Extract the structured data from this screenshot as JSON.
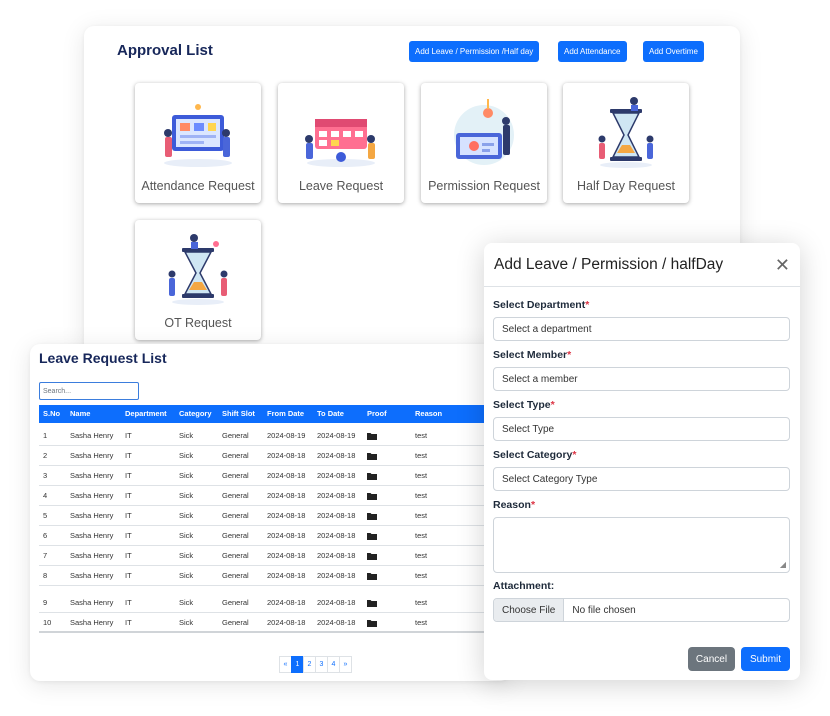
{
  "approval": {
    "title": "Approval List",
    "buttons": [
      "Add Leave / Permission /Half day",
      "Add Attendance",
      "Add Overtime"
    ],
    "tiles": [
      "Attendance Request",
      "Leave Request",
      "Permission Request",
      "Half Day Request",
      "OT Request"
    ]
  },
  "leave_list": {
    "title": "Leave Request List",
    "search_placeholder": "Search...",
    "columns": [
      "S.No",
      "Name",
      "Department",
      "Category",
      "Shift Slot",
      "From Date",
      "To Date",
      "Proof",
      "Reason"
    ],
    "rows": [
      [
        "1",
        "Sasha Henry",
        "IT",
        "Sick",
        "General",
        "2024-08-19",
        "2024-08-19",
        "test"
      ],
      [
        "2",
        "Sasha Henry",
        "IT",
        "Sick",
        "General",
        "2024-08-18",
        "2024-08-18",
        "test"
      ],
      [
        "3",
        "Sasha Henry",
        "IT",
        "Sick",
        "General",
        "2024-08-18",
        "2024-08-18",
        "test"
      ],
      [
        "4",
        "Sasha Henry",
        "IT",
        "Sick",
        "General",
        "2024-08-18",
        "2024-08-18",
        "test"
      ],
      [
        "5",
        "Sasha Henry",
        "IT",
        "Sick",
        "General",
        "2024-08-18",
        "2024-08-18",
        "test"
      ],
      [
        "6",
        "Sasha Henry",
        "IT",
        "Sick",
        "General",
        "2024-08-18",
        "2024-08-18",
        "test"
      ],
      [
        "7",
        "Sasha Henry",
        "IT",
        "Sick",
        "General",
        "2024-08-18",
        "2024-08-18",
        "test"
      ],
      [
        "8",
        "Sasha Henry",
        "IT",
        "Sick",
        "General",
        "2024-08-18",
        "2024-08-18",
        "test"
      ],
      [
        "9",
        "Sasha Henry",
        "IT",
        "Sick",
        "General",
        "2024-08-18",
        "2024-08-18",
        "test"
      ],
      [
        "10",
        "Sasha Henry",
        "IT",
        "Sick",
        "General",
        "2024-08-18",
        "2024-08-18",
        "test"
      ]
    ],
    "proof_icon": "folder-icon",
    "pagination": {
      "prev": "«",
      "pages": [
        "1",
        "2",
        "3",
        "4"
      ],
      "current": "1",
      "next": "»"
    }
  },
  "modal": {
    "title": "Add Leave / Permission / halfDay",
    "close": "✕",
    "required_mark": "*",
    "fields": {
      "department": {
        "label": "Select Department",
        "value": "Select a department"
      },
      "member": {
        "label": "Select Member",
        "value": "Select a member"
      },
      "type": {
        "label": "Select Type",
        "value": "Select Type"
      },
      "category": {
        "label": "Select Category",
        "value": "Select Category Type"
      },
      "reason": {
        "label": "Reason",
        "value": ""
      },
      "attachment": {
        "label": "Attachment:",
        "button": "Choose File",
        "status": "No file chosen"
      }
    },
    "cancel": "Cancel",
    "submit": "Submit"
  },
  "colors": {
    "primary": "#0d6efd",
    "title": "#17275a",
    "required": "#dc3545",
    "secondary": "#6c757d"
  }
}
